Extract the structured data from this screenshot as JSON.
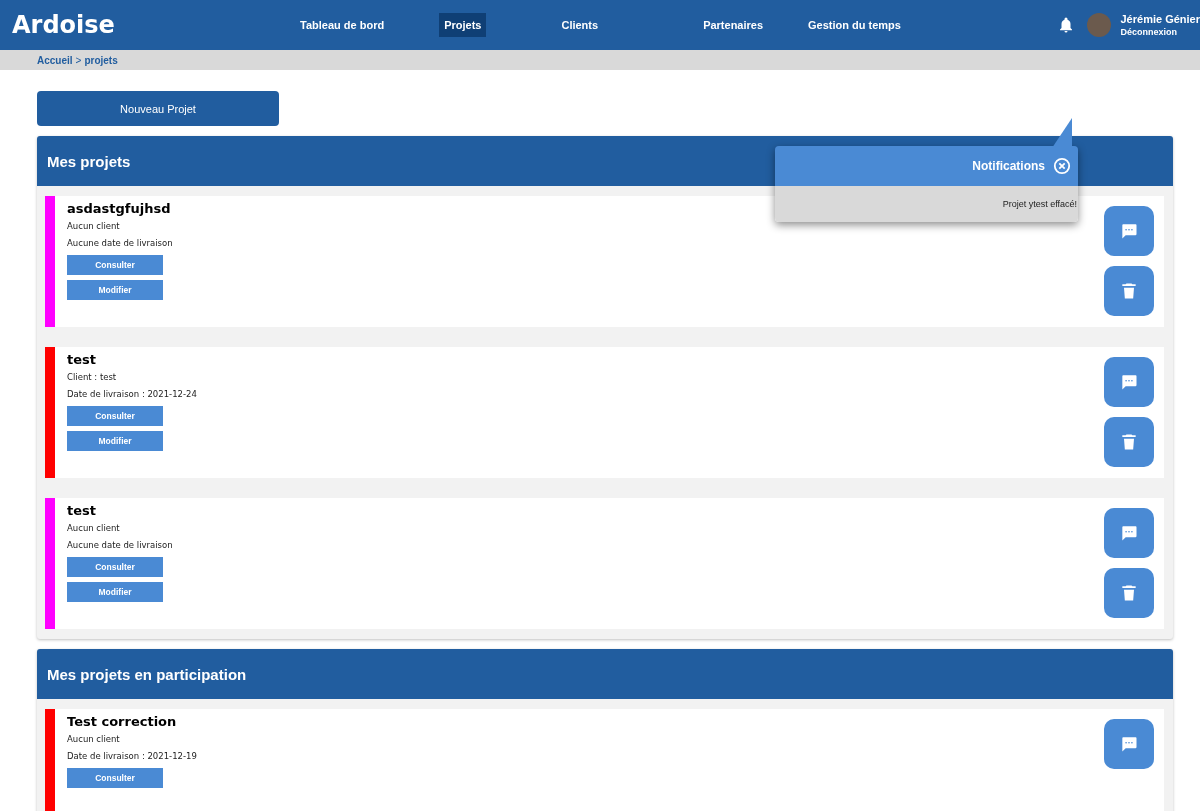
{
  "header": {
    "logo": "Ardoise",
    "nav": [
      {
        "label": "Tableau de bord",
        "selected": false
      },
      {
        "label": "Projets",
        "selected": true
      },
      {
        "label": "Clients",
        "selected": false
      },
      {
        "label": "Partenaires",
        "selected": false
      },
      {
        "label": "Gestion du temps",
        "selected": false
      }
    ],
    "user": {
      "name": "Jérémie Génier",
      "logout": "Déconnexion"
    }
  },
  "breadcrumb": {
    "home": "Accueil",
    "separator": ">",
    "current": "projets"
  },
  "new_project_button": "Nouveau Projet",
  "notification": {
    "title": "Notifications",
    "message": "Projet ytest effacé!"
  },
  "sections": [
    {
      "title": "Mes projets",
      "projects": [
        {
          "name": "asdastgfujhsd",
          "color": "#ff00ff",
          "client": "Aucun client",
          "delivery": "Aucune date de livraison",
          "buttons": [
            "Consulter",
            "Modifier"
          ],
          "deletable": true
        },
        {
          "name": "test",
          "color": "#ff0000",
          "client": "Client : test",
          "delivery": "Date de livraison : 2021-12-24",
          "buttons": [
            "Consulter",
            "Modifier"
          ],
          "deletable": true
        },
        {
          "name": "test",
          "color": "#ff00ff",
          "client": "Aucun client",
          "delivery": "Aucune date de livraison",
          "buttons": [
            "Consulter",
            "Modifier"
          ],
          "deletable": true
        }
      ]
    },
    {
      "title": "Mes projets en participation",
      "projects": [
        {
          "name": "Test correction",
          "color": "#ff0000",
          "client": "Aucun client",
          "delivery": "Date de livraison : 2021-12-19",
          "buttons": [
            "Consulter"
          ],
          "deletable": false
        }
      ]
    }
  ]
}
